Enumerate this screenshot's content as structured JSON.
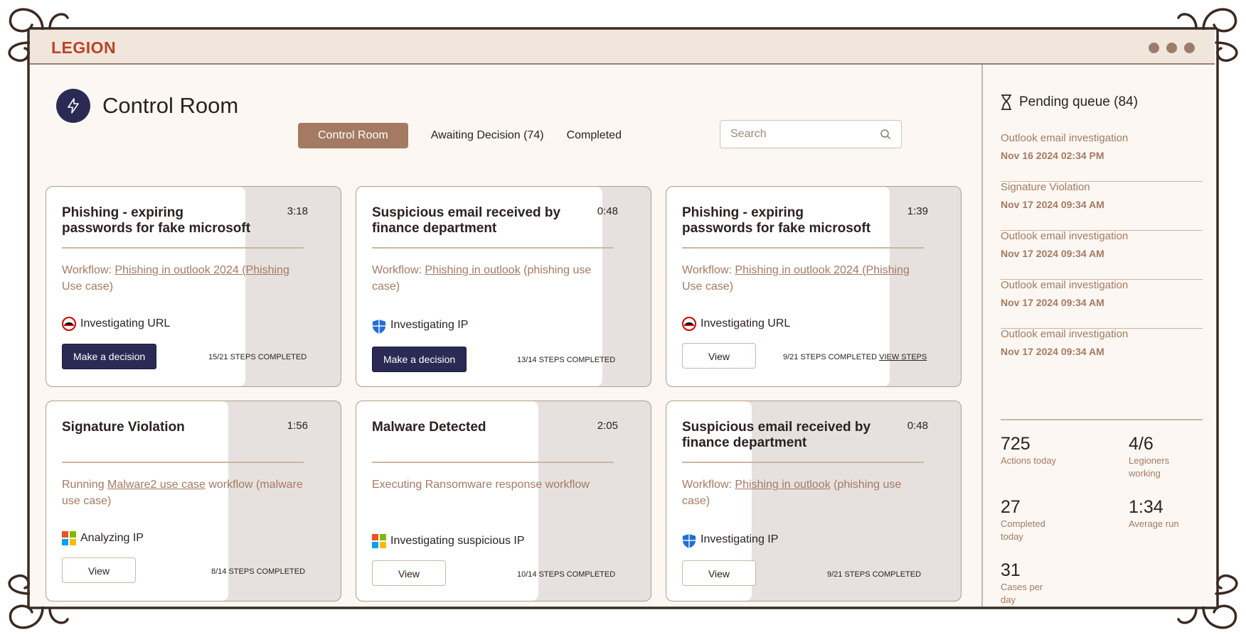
{
  "app": {
    "logo": "LEGION"
  },
  "header": {
    "title": "Control Room",
    "tabs": [
      {
        "label": "Control Room",
        "active": true
      },
      {
        "label": "Awaiting Decision (74)",
        "active": false
      },
      {
        "label": "Completed",
        "active": false
      }
    ],
    "search_placeholder": "Search"
  },
  "cards": [
    {
      "title": "Phishing - expiring passwords for fake microsoft",
      "time": "3:18",
      "workflow_prefix": "Workflow: ",
      "workflow_link": "Phishing in outlook 2024 (Phishing",
      "workflow_suffix": " Use case)",
      "status": "Investigating URL",
      "status_icon": "redhat-icon",
      "action": "Make a decision",
      "steps": "15/21 STEPS COMPLETED",
      "progress": 0.71
    },
    {
      "title": "Suspicious email received by finance department",
      "time": "0:48",
      "workflow_prefix": "Workflow: ",
      "workflow_link": "Phishing in outlook",
      "workflow_suffix": " (phishing use case)",
      "status": "Investigating IP",
      "status_icon": "shield-icon",
      "action": "Make a decision",
      "steps": "13/14 STEPS COMPLETED",
      "progress": 0.93
    },
    {
      "title": "Phishing - expiring passwords for fake microsoft",
      "time": "1:39",
      "workflow_prefix": "Workflow: ",
      "workflow_link": "Phishing in outlook 2024 (Phishing",
      "workflow_suffix": " Use case)",
      "status": "Investigating URL",
      "status_icon": "redhat-icon",
      "action": "View",
      "steps": "9/21 STEPS COMPLETED",
      "steps_link": "VIEW STEPS",
      "progress": 0.43
    },
    {
      "title": "Signature Violation",
      "time": "1:56",
      "workflow_prefix": "Running ",
      "workflow_link": "Malware2 use case",
      "workflow_suffix": " workflow (malware use case)",
      "status": "Analyzing IP",
      "status_icon": "windows-icon",
      "action": "View",
      "steps": "8/14 STEPS COMPLETED",
      "progress": 0.57
    },
    {
      "title": "Malware Detected",
      "time": "2:05",
      "workflow_prefix": "Executing Ransomware response workflow",
      "workflow_link": "",
      "workflow_suffix": "",
      "status": "Investigating suspicious IP",
      "status_icon": "windows-icon",
      "action": "View",
      "steps": "10/14 STEPS COMPLETED",
      "progress": 0.71
    },
    {
      "title": "Suspicious email received by finance department",
      "time": "0:48",
      "workflow_prefix": "Workflow: ",
      "workflow_link": "Phishing in outlook",
      "workflow_suffix": " (phishing use case)",
      "status": "Investigating IP",
      "status_icon": "shield-icon",
      "action": "View",
      "steps": "9/21 STEPS COMPLETED",
      "progress": 0.29
    }
  ],
  "sidebar": {
    "pending_title": "Pending queue (84)",
    "queue": [
      {
        "title": "Outlook email investigation",
        "date": "Nov 16 2024 02:34 PM"
      },
      {
        "title": "Signature Violation",
        "date": "Nov 17 2024 09:34 AM"
      },
      {
        "title": "Outlook email investigation",
        "date": "Nov 17 2024 09:34 AM"
      },
      {
        "title": "Outlook email investigation",
        "date": "Nov 17 2024 09:34 AM"
      },
      {
        "title": "Outlook email investigation",
        "date": "Nov 17 2024 09:34 AM"
      }
    ],
    "stats": [
      {
        "value": "725",
        "label": "Actions today"
      },
      {
        "value": "4/6",
        "label": "Legioners working"
      },
      {
        "value": "27",
        "label": "Completed today"
      },
      {
        "value": "1:34",
        "label": "Average run"
      },
      {
        "value": "31",
        "label": "Cases per day"
      }
    ]
  },
  "colors": {
    "accent": "#a57a62",
    "navy": "#2a2a55",
    "logo": "#b8442b"
  }
}
